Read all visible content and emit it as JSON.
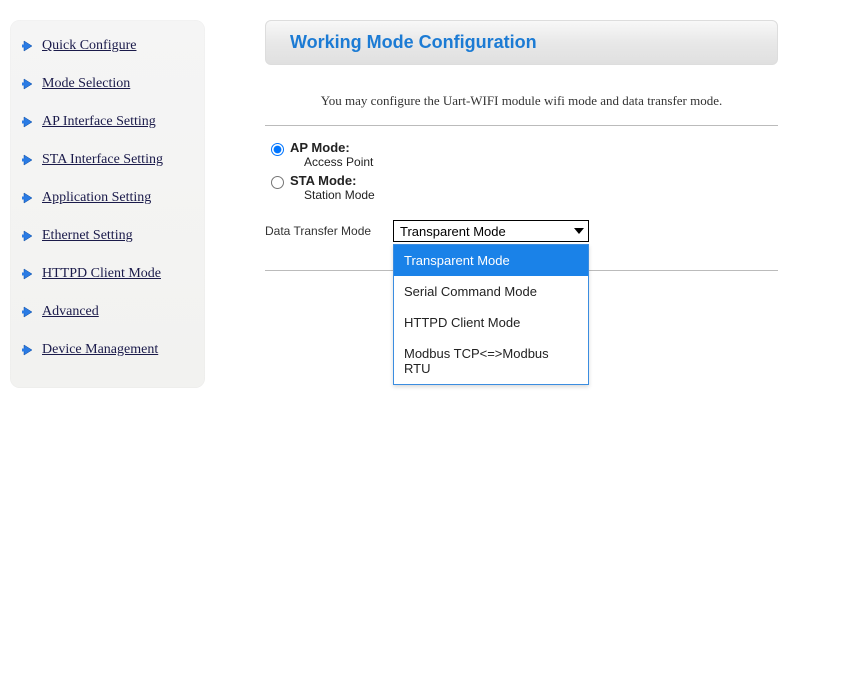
{
  "sidebar": {
    "items": [
      {
        "label": "Quick Configure"
      },
      {
        "label": "Mode Selection"
      },
      {
        "label": "AP Interface Setting"
      },
      {
        "label": "STA Interface Setting"
      },
      {
        "label": "Application Setting"
      },
      {
        "label": "Ethernet Setting"
      },
      {
        "label": "HTTPD Client Mode"
      },
      {
        "label": "Advanced"
      },
      {
        "label": "Device Management"
      }
    ]
  },
  "page": {
    "title": "Working Mode Configuration",
    "description": "You may configure the Uart-WIFI module wifi mode and data transfer mode."
  },
  "mode": {
    "ap": {
      "label": "AP Mode:",
      "sub": "Access Point",
      "checked": true
    },
    "sta": {
      "label": "STA Mode:",
      "sub": "Station Mode",
      "checked": false
    }
  },
  "transfer": {
    "label": "Data Transfer Mode",
    "selected": "Transparent Mode",
    "options": [
      "Transparent Mode",
      "Serial Command Mode",
      "HTTPD Client Mode",
      "Modbus TCP<=>Modbus RTU"
    ]
  }
}
